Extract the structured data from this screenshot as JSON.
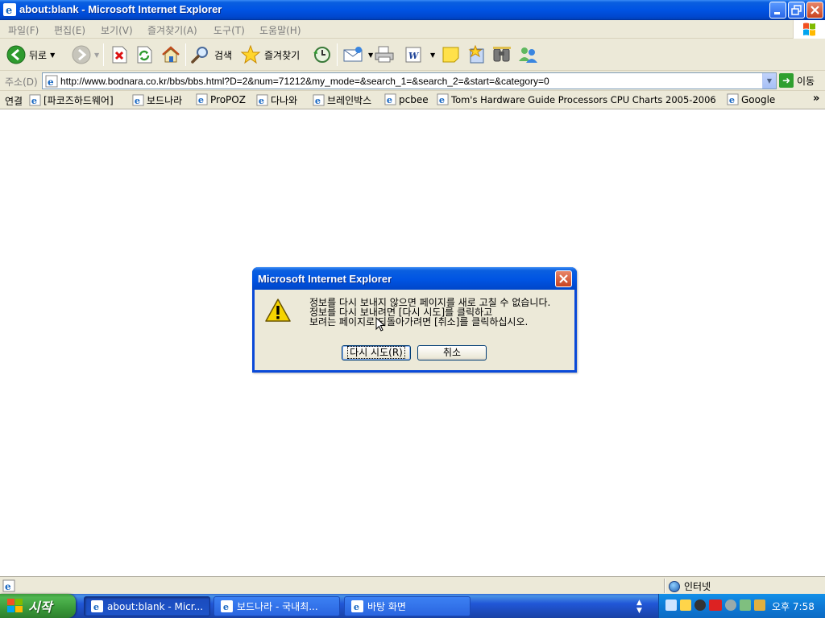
{
  "window": {
    "title": "about:blank - Microsoft Internet Explorer",
    "minimize": "🗕",
    "maximize": "🗗",
    "close": "✕"
  },
  "menu": {
    "items": [
      "파일(F)",
      "편집(E)",
      "보기(V)",
      "즐겨찾기(A)",
      "도구(T)",
      "도움말(H)"
    ]
  },
  "toolbar": {
    "back_label": "뒤로",
    "search_label": "검색",
    "favorites_label": "즐겨찾기"
  },
  "address": {
    "label": "주소(D)",
    "url": "http://www.bodnara.co.kr/bbs/bbs.html?D=2&num=71212&my_mode=&search_1=&search_2=&start=&category=0",
    "go_label": "이동"
  },
  "links": {
    "label": "연결",
    "items": [
      "[파코즈하드웨어]",
      "보드나라",
      "ProPOZ",
      "다나와",
      "브레인박스",
      "pcbee",
      "Tom's Hardware Guide Processors CPU Charts 2005-2006",
      "Google"
    ],
    "more": "»"
  },
  "dialog": {
    "title": "Microsoft Internet Explorer",
    "close": "✕",
    "message_lines": [
      "정보를 다시 보내지 않으면 페이지를 새로 고칠 수 없습니다.",
      "정보를 다시 보내려면 [다시 시도]를 클릭하고",
      "보려는 페이지로 되돌아가려면 [취소]를 클릭하십시오."
    ],
    "retry_label": "다시 시도(R)",
    "cancel_label": "취소"
  },
  "status": {
    "text": "",
    "zone": "인터넷"
  },
  "taskbar": {
    "start_label": "시작",
    "tasks": [
      "about:blank - Micr...",
      "보드나라 - 국내최...",
      "바탕 화면"
    ],
    "clock": "오후 7:58"
  },
  "colors": {
    "titlebar": "#0054e3",
    "chrome": "#ece9d8",
    "start_green": "#3a9a3a",
    "taskbar_blue": "#2157d7",
    "warning_yellow": "#f5d400"
  }
}
